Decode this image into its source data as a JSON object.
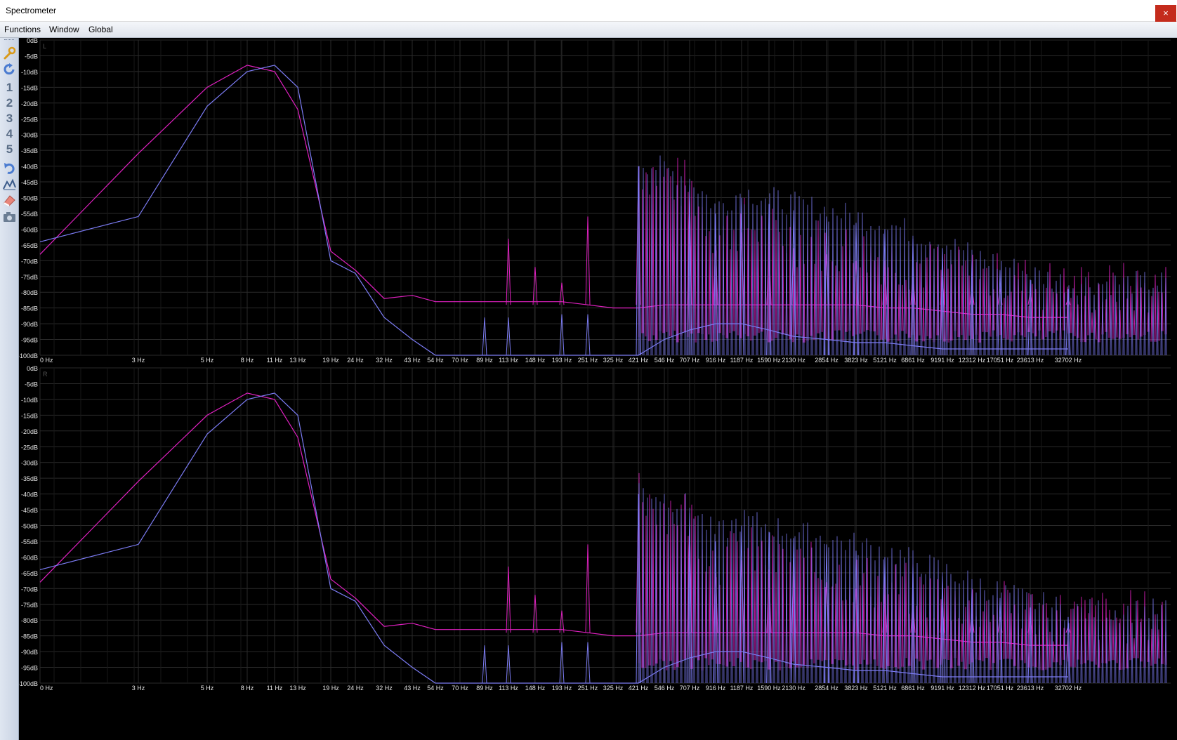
{
  "window": {
    "title": "Spectrometer",
    "close_glyph": "×"
  },
  "menu": [
    {
      "label": "Functions"
    },
    {
      "label": "Window"
    },
    {
      "label": "Global"
    }
  ],
  "toolbar": [
    {
      "name": "settings-wrench-icon",
      "glyph": ""
    },
    {
      "name": "refresh-icon",
      "glyph": ""
    },
    {
      "name": "preset-1-button",
      "glyph": "1"
    },
    {
      "name": "preset-2-button",
      "glyph": "2"
    },
    {
      "name": "preset-3-button",
      "glyph": "3"
    },
    {
      "name": "preset-4-button",
      "glyph": "4"
    },
    {
      "name": "preset-5-button",
      "glyph": "5"
    },
    {
      "name": "undo-icon",
      "glyph": ""
    },
    {
      "name": "peak-hold-icon",
      "glyph": ""
    },
    {
      "name": "eraser-icon",
      "glyph": ""
    },
    {
      "name": "camera-snapshot-icon",
      "glyph": ""
    }
  ],
  "colors": {
    "background": "#000000",
    "grid": "#2a2a2a",
    "label": "#e6e6e6",
    "magenta": "#e020c0",
    "blue": "#7c7cf4"
  },
  "chart_data": [
    {
      "type": "line",
      "channel": "L",
      "y_labels": [
        "0dB",
        "-5dB",
        "-10dB",
        "-15dB",
        "-20dB",
        "-25dB",
        "-30dB",
        "-35dB",
        "-40dB",
        "-45dB",
        "-50dB",
        "-55dB",
        "-60dB",
        "-65dB",
        "-70dB",
        "-75dB",
        "-80dB",
        "-85dB",
        "-90dB",
        "-95dB",
        "-100dB"
      ],
      "ylim": [
        -100,
        0
      ],
      "x_labels": [
        "0 Hz",
        "3 Hz",
        "5 Hz",
        "8 Hz",
        "11 Hz",
        "13 Hz",
        "19 Hz",
        "24 Hz",
        "32 Hz",
        "43 Hz",
        "54 Hz",
        "70 Hz",
        "89 Hz",
        "113 Hz",
        "148 Hz",
        "193 Hz",
        "251 Hz",
        "325 Hz",
        "421 Hz",
        "546 Hz",
        "707 Hz",
        "916 Hz",
        "1187 Hz",
        "1590 Hz",
        "2130 Hz",
        "2854 Hz",
        "3823 Hz",
        "5121 Hz",
        "6861 Hz",
        "9191 Hz",
        "12312 Hz",
        "17051 Hz",
        "23613 Hz",
        "32702 Hz"
      ],
      "series": [
        {
          "color": "#e020c0",
          "x": [
            "0 Hz",
            "3 Hz",
            "5 Hz",
            "8 Hz",
            "11 Hz",
            "13 Hz",
            "19 Hz",
            "24 Hz",
            "32 Hz",
            "43 Hz",
            "54 Hz",
            "70 Hz",
            "89 Hz",
            "113 Hz",
            "148 Hz",
            "193 Hz",
            "251 Hz",
            "325 Hz",
            "421 Hz",
            "546 Hz",
            "707 Hz",
            "916 Hz",
            "1187 Hz",
            "1590 Hz",
            "2130 Hz",
            "2854 Hz",
            "3823 Hz",
            "5121 Hz",
            "6861 Hz",
            "9191 Hz",
            "12312 Hz",
            "17051 Hz",
            "23613 Hz",
            "32702 Hz"
          ],
          "values": [
            -68,
            -36,
            -15,
            -8,
            -10,
            -22,
            -67,
            -73,
            -82,
            -81,
            -83,
            -83,
            -83,
            -83,
            -83,
            -83,
            -84,
            -85,
            -85,
            -84,
            -84,
            -84,
            -84,
            -84,
            -84,
            -84,
            -84,
            -85,
            -85,
            -86,
            -87,
            -87,
            -88,
            -88
          ],
          "peaks": [
            [
              "113 Hz",
              -63
            ],
            [
              "148 Hz",
              -72
            ],
            [
              "193 Hz",
              -77
            ],
            [
              "251 Hz",
              -56
            ],
            [
              "421 Hz",
              -43
            ],
            [
              "707 Hz",
              -50
            ],
            [
              "916 Hz",
              -65
            ],
            [
              "1187 Hz",
              -61
            ],
            [
              "1590 Hz",
              -64
            ],
            [
              "2130 Hz",
              -66
            ],
            [
              "2854 Hz",
              -68
            ],
            [
              "3823 Hz",
              -70
            ],
            [
              "5121 Hz",
              -72
            ],
            [
              "6861 Hz",
              -74
            ],
            [
              "9191 Hz",
              -76
            ],
            [
              "12312 Hz",
              -78
            ],
            [
              "17051 Hz",
              -79
            ],
            [
              "23613 Hz",
              -80
            ],
            [
              "32702 Hz",
              -82
            ]
          ]
        },
        {
          "color": "#7c7cf4",
          "x": [
            "0 Hz",
            "3 Hz",
            "5 Hz",
            "8 Hz",
            "11 Hz",
            "13 Hz",
            "19 Hz",
            "24 Hz",
            "32 Hz",
            "43 Hz",
            "54 Hz",
            "70 Hz",
            "89 Hz",
            "113 Hz",
            "148 Hz",
            "193 Hz",
            "251 Hz",
            "325 Hz",
            "421 Hz",
            "546 Hz",
            "707 Hz",
            "916 Hz",
            "1187 Hz",
            "1590 Hz",
            "2130 Hz",
            "2854 Hz",
            "3823 Hz",
            "5121 Hz",
            "6861 Hz",
            "9191 Hz",
            "12312 Hz",
            "17051 Hz",
            "23613 Hz",
            "32702 Hz"
          ],
          "values": [
            -64,
            -56,
            -21,
            -10,
            -8,
            -15,
            -70,
            -74,
            -88,
            -95,
            -100,
            -100,
            -100,
            -100,
            -100,
            -100,
            -100,
            -100,
            -100,
            -95,
            -92,
            -90,
            -90,
            -92,
            -94,
            -95,
            -96,
            -96,
            -97,
            -98,
            -98,
            -98,
            -98,
            -98
          ],
          "peaks": [
            [
              "89 Hz",
              -88
            ],
            [
              "113 Hz",
              -88
            ],
            [
              "193 Hz",
              -87
            ],
            [
              "251 Hz",
              -87
            ],
            [
              "421 Hz",
              -40
            ],
            [
              "707 Hz",
              -46
            ],
            [
              "916 Hz",
              -55
            ],
            [
              "1187 Hz",
              -50
            ],
            [
              "1590 Hz",
              -52
            ],
            [
              "2130 Hz",
              -54
            ],
            [
              "2854 Hz",
              -56
            ],
            [
              "3823 Hz",
              -58
            ],
            [
              "5121 Hz",
              -60
            ],
            [
              "6861 Hz",
              -63
            ],
            [
              "9191 Hz",
              -66
            ],
            [
              "12312 Hz",
              -70
            ],
            [
              "17051 Hz",
              -73
            ],
            [
              "23613 Hz",
              -76
            ],
            [
              "32702 Hz",
              -79
            ]
          ]
        }
      ]
    },
    {
      "type": "line",
      "channel": "R",
      "y_labels": [
        "0dB",
        "-5dB",
        "-10dB",
        "-15dB",
        "-20dB",
        "-25dB",
        "-30dB",
        "-35dB",
        "-40dB",
        "-45dB",
        "-50dB",
        "-55dB",
        "-60dB",
        "-65dB",
        "-70dB",
        "-75dB",
        "-80dB",
        "-85dB",
        "-90dB",
        "-95dB",
        "-100dB"
      ],
      "ylim": [
        -100,
        0
      ],
      "x_labels": [
        "0 Hz",
        "3 Hz",
        "5 Hz",
        "8 Hz",
        "11 Hz",
        "13 Hz",
        "19 Hz",
        "24 Hz",
        "32 Hz",
        "43 Hz",
        "54 Hz",
        "70 Hz",
        "89 Hz",
        "113 Hz",
        "148 Hz",
        "193 Hz",
        "251 Hz",
        "325 Hz",
        "421 Hz",
        "546 Hz",
        "707 Hz",
        "916 Hz",
        "1187 Hz",
        "1590 Hz",
        "2130 Hz",
        "2854 Hz",
        "3823 Hz",
        "5121 Hz",
        "6861 Hz",
        "9191 Hz",
        "12312 Hz",
        "17051 Hz",
        "23613 Hz",
        "32702 Hz"
      ],
      "series": [
        {
          "color": "#e020c0",
          "x": [
            "0 Hz",
            "3 Hz",
            "5 Hz",
            "8 Hz",
            "11 Hz",
            "13 Hz",
            "19 Hz",
            "24 Hz",
            "32 Hz",
            "43 Hz",
            "54 Hz",
            "70 Hz",
            "89 Hz",
            "113 Hz",
            "148 Hz",
            "193 Hz",
            "251 Hz",
            "325 Hz",
            "421 Hz",
            "546 Hz",
            "707 Hz",
            "916 Hz",
            "1187 Hz",
            "1590 Hz",
            "2130 Hz",
            "2854 Hz",
            "3823 Hz",
            "5121 Hz",
            "6861 Hz",
            "9191 Hz",
            "12312 Hz",
            "17051 Hz",
            "23613 Hz",
            "32702 Hz"
          ],
          "values": [
            -68,
            -36,
            -15,
            -8,
            -10,
            -22,
            -67,
            -73,
            -82,
            -81,
            -83,
            -83,
            -83,
            -83,
            -83,
            -83,
            -84,
            -85,
            -85,
            -84,
            -84,
            -84,
            -84,
            -84,
            -84,
            -84,
            -84,
            -85,
            -85,
            -86,
            -87,
            -87,
            -88,
            -88
          ],
          "peaks": [
            [
              "113 Hz",
              -63
            ],
            [
              "148 Hz",
              -72
            ],
            [
              "193 Hz",
              -77
            ],
            [
              "251 Hz",
              -56
            ],
            [
              "421 Hz",
              -43
            ],
            [
              "707 Hz",
              -50
            ],
            [
              "916 Hz",
              -65
            ],
            [
              "1187 Hz",
              -61
            ],
            [
              "1590 Hz",
              -64
            ],
            [
              "2130 Hz",
              -66
            ],
            [
              "2854 Hz",
              -68
            ],
            [
              "3823 Hz",
              -70
            ],
            [
              "5121 Hz",
              -72
            ],
            [
              "6861 Hz",
              -74
            ],
            [
              "9191 Hz",
              -76
            ],
            [
              "12312 Hz",
              -78
            ],
            [
              "17051 Hz",
              -79
            ],
            [
              "23613 Hz",
              -80
            ],
            [
              "32702 Hz",
              -82
            ]
          ]
        },
        {
          "color": "#7c7cf4",
          "x": [
            "0 Hz",
            "3 Hz",
            "5 Hz",
            "8 Hz",
            "11 Hz",
            "13 Hz",
            "19 Hz",
            "24 Hz",
            "32 Hz",
            "43 Hz",
            "54 Hz",
            "70 Hz",
            "89 Hz",
            "113 Hz",
            "148 Hz",
            "193 Hz",
            "251 Hz",
            "325 Hz",
            "421 Hz",
            "546 Hz",
            "707 Hz",
            "916 Hz",
            "1187 Hz",
            "1590 Hz",
            "2130 Hz",
            "2854 Hz",
            "3823 Hz",
            "5121 Hz",
            "6861 Hz",
            "9191 Hz",
            "12312 Hz",
            "17051 Hz",
            "23613 Hz",
            "32702 Hz"
          ],
          "values": [
            -64,
            -56,
            -21,
            -10,
            -8,
            -15,
            -70,
            -74,
            -88,
            -95,
            -100,
            -100,
            -100,
            -100,
            -100,
            -100,
            -100,
            -100,
            -100,
            -95,
            -92,
            -90,
            -90,
            -92,
            -94,
            -95,
            -96,
            -96,
            -97,
            -98,
            -98,
            -98,
            -98,
            -98
          ],
          "peaks": [
            [
              "89 Hz",
              -88
            ],
            [
              "113 Hz",
              -88
            ],
            [
              "193 Hz",
              -87
            ],
            [
              "251 Hz",
              -87
            ],
            [
              "421 Hz",
              -40
            ],
            [
              "707 Hz",
              -46
            ],
            [
              "916 Hz",
              -55
            ],
            [
              "1187 Hz",
              -50
            ],
            [
              "1590 Hz",
              -52
            ],
            [
              "2130 Hz",
              -54
            ],
            [
              "2854 Hz",
              -56
            ],
            [
              "3823 Hz",
              -58
            ],
            [
              "5121 Hz",
              -60
            ],
            [
              "6861 Hz",
              -63
            ],
            [
              "9191 Hz",
              -66
            ],
            [
              "12312 Hz",
              -70
            ],
            [
              "17051 Hz",
              -73
            ],
            [
              "23613 Hz",
              -76
            ],
            [
              "32702 Hz",
              -79
            ]
          ]
        }
      ]
    }
  ]
}
